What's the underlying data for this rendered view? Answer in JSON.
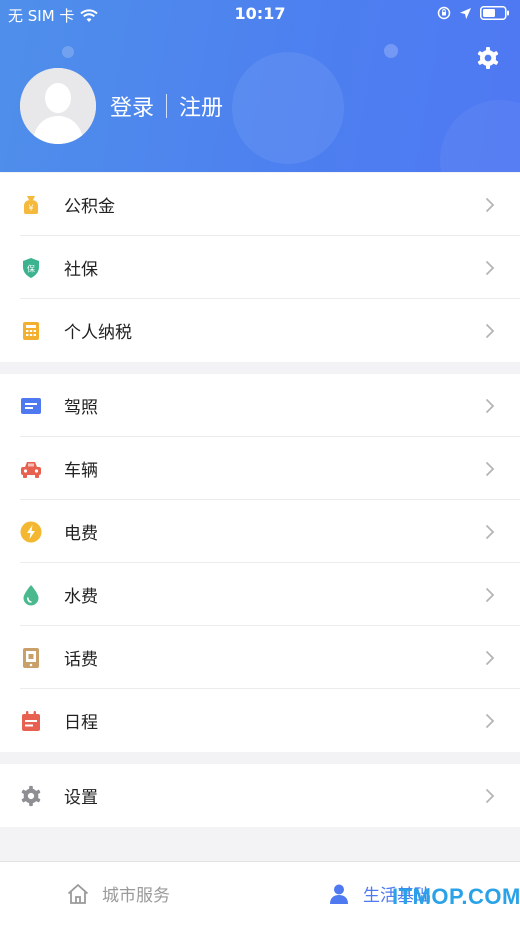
{
  "status_bar": {
    "carrier": "无 SIM 卡",
    "time": "10:17"
  },
  "header": {
    "login_label": "登录",
    "register_label": "注册"
  },
  "groups": [
    {
      "items": [
        {
          "label": "公积金",
          "icon": "housing-fund-icon",
          "color": "#f5b93b"
        },
        {
          "label": "社保",
          "icon": "social-security-icon",
          "color": "#3bb38f"
        },
        {
          "label": "个人纳税",
          "icon": "tax-calculator-icon",
          "color": "#f3b02f"
        }
      ]
    },
    {
      "items": [
        {
          "label": "驾照",
          "icon": "driver-license-icon",
          "color": "#4e79f0"
        },
        {
          "label": "车辆",
          "icon": "car-icon",
          "color": "#e8604f"
        },
        {
          "label": "电费",
          "icon": "electricity-icon",
          "color": "#f4b732"
        },
        {
          "label": "水费",
          "icon": "water-drop-icon",
          "color": "#4bb98e"
        },
        {
          "label": "话费",
          "icon": "phone-bill-icon",
          "color": "#c9a06a"
        },
        {
          "label": "日程",
          "icon": "calendar-icon",
          "color": "#e8604f"
        }
      ]
    },
    {
      "items": [
        {
          "label": "设置",
          "icon": "settings-gear-icon",
          "color": "#8e8e93"
        }
      ]
    }
  ],
  "tabs": [
    {
      "label": "城市服务",
      "icon": "home-icon",
      "active": false,
      "color": "#9a9a9a"
    },
    {
      "label": "生活基础",
      "icon": "person-icon",
      "active": true,
      "color": "#4e79f0"
    }
  ],
  "watermark": "ITMOP.COM"
}
